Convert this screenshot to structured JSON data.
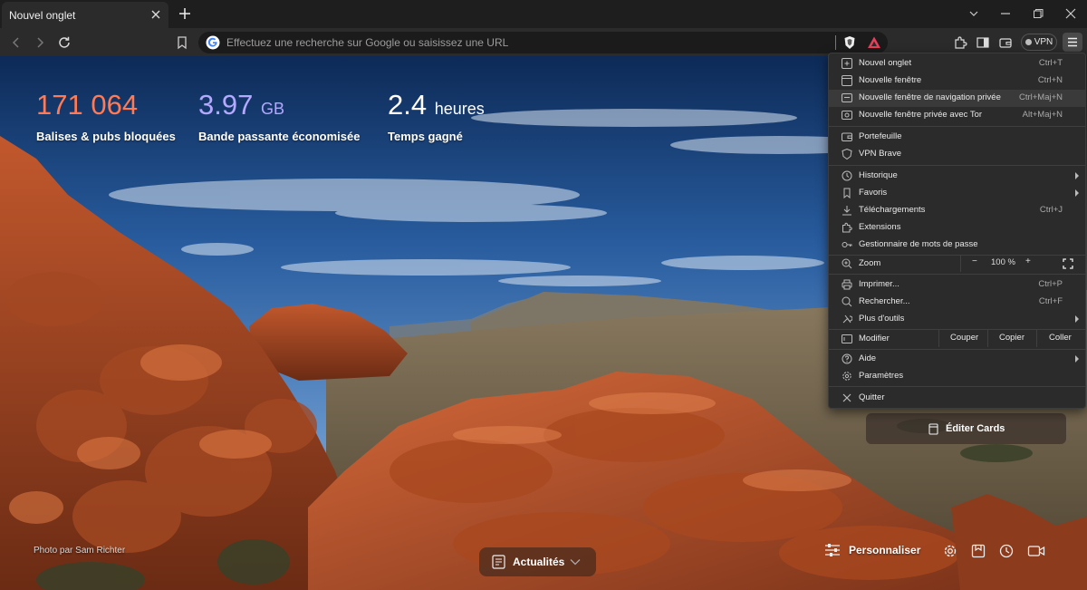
{
  "tab": {
    "title": "Nouvel onglet"
  },
  "omnibox": {
    "placeholder": "Effectuez une recherche sur Google ou saisissez une URL"
  },
  "toolbar": {
    "vpn_label": "VPN"
  },
  "stats": [
    {
      "value": "171 064",
      "unit": "",
      "label": "Balises & pubs bloquées",
      "color": "#ff7a55"
    },
    {
      "value": "3.97",
      "unit": "GB",
      "label": "Bande passante économisée",
      "color": "#b4a8ff"
    },
    {
      "value": "2.4",
      "unit": "heures",
      "label": "Temps gagné",
      "color": "#ffffff"
    }
  ],
  "bottom": {
    "photo_credit": "Photo par Sam Richter",
    "news_label": "Actualités",
    "customize_label": "Personnaliser",
    "edit_cards_label": "Éditer Cards"
  },
  "menu": {
    "new_tab": {
      "label": "Nouvel onglet",
      "shortcut": "Ctrl+T"
    },
    "new_window": {
      "label": "Nouvelle fenêtre",
      "shortcut": "Ctrl+N"
    },
    "new_private": {
      "label": "Nouvelle fenêtre de navigation privée",
      "shortcut": "Ctrl+Maj+N"
    },
    "new_tor": {
      "label": "Nouvelle fenêtre privée avec Tor",
      "shortcut": "Alt+Maj+N"
    },
    "wallet": {
      "label": "Portefeuille"
    },
    "vpn": {
      "label": "VPN Brave"
    },
    "history": {
      "label": "Historique"
    },
    "bookmarks": {
      "label": "Favoris"
    },
    "downloads": {
      "label": "Téléchargements",
      "shortcut": "Ctrl+J"
    },
    "extensions": {
      "label": "Extensions"
    },
    "passwords": {
      "label": "Gestionnaire de mots de passe"
    },
    "zoom": {
      "label": "Zoom",
      "minus": "−",
      "value": "100 %",
      "plus": "+"
    },
    "print": {
      "label": "Imprimer...",
      "shortcut": "Ctrl+P"
    },
    "find": {
      "label": "Rechercher...",
      "shortcut": "Ctrl+F"
    },
    "more_tools": {
      "label": "Plus d'outils"
    },
    "edit": {
      "label": "Modifier",
      "cut": "Couper",
      "copy": "Copier",
      "paste": "Coller"
    },
    "help": {
      "label": "Aide"
    },
    "settings": {
      "label": "Paramètres"
    },
    "quit": {
      "label": "Quitter"
    }
  }
}
